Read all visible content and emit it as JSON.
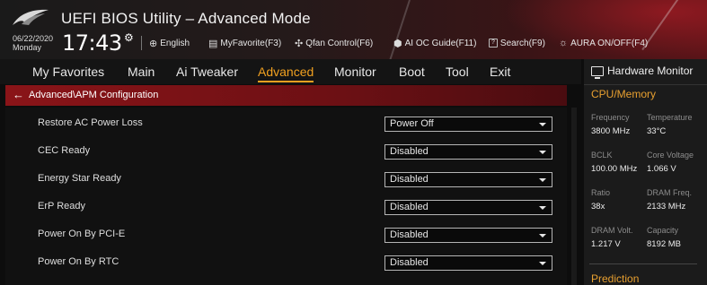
{
  "header": {
    "app_title": "UEFI BIOS Utility – Advanced Mode",
    "date": "06/22/2020",
    "day": "Monday",
    "time": "17:43",
    "buttons": {
      "language": "English",
      "myfavorite": "MyFavorite(F3)",
      "qfan": "Qfan Control(F6)",
      "ai_oc": "AI OC Guide(F11)",
      "search": "Search(F9)",
      "aura": "AURA ON/OFF(F4)"
    }
  },
  "menu": {
    "items": [
      "My Favorites",
      "Main",
      "Ai Tweaker",
      "Advanced",
      "Monitor",
      "Boot",
      "Tool",
      "Exit"
    ],
    "active": "Advanced"
  },
  "breadcrumb": "Advanced\\APM Configuration",
  "settings": [
    {
      "label": "Restore AC Power Loss",
      "value": "Power Off"
    },
    {
      "label": "CEC Ready",
      "value": "Disabled"
    },
    {
      "label": "Energy Star Ready",
      "value": "Disabled"
    },
    {
      "label": "ErP Ready",
      "value": "Disabled"
    },
    {
      "label": "Power On By PCI-E",
      "value": "Disabled"
    },
    {
      "label": "Power On By RTC",
      "value": "Disabled"
    }
  ],
  "hardware_monitor": {
    "title": "Hardware Monitor",
    "section": "CPU/Memory",
    "stats": [
      {
        "label": "Frequency",
        "value": "3800 MHz"
      },
      {
        "label": "Temperature",
        "value": "33°C"
      },
      {
        "label": "BCLK",
        "value": "100.00 MHz"
      },
      {
        "label": "Core Voltage",
        "value": "1.066 V"
      },
      {
        "label": "Ratio",
        "value": "38x"
      },
      {
        "label": "DRAM Freq.",
        "value": "2133 MHz"
      },
      {
        "label": "DRAM Volt.",
        "value": "1.217 V"
      },
      {
        "label": "Capacity",
        "value": "8192 MB"
      }
    ],
    "prediction": "Prediction"
  },
  "colors": {
    "accent": "#f0a020",
    "breadcrumb_red": "#8a1418",
    "panel": "#1b1b1b"
  },
  "icons": {
    "logo": "rog-logo-icon",
    "gear": "gear-icon",
    "language": "globe-icon",
    "myfavorite": "star-box-icon",
    "qfan": "fan-icon",
    "ai_oc": "ai-chip-icon",
    "search": "search-box-icon",
    "aura": "aura-light-icon",
    "back": "back-arrow-icon",
    "monitor": "monitor-icon"
  }
}
